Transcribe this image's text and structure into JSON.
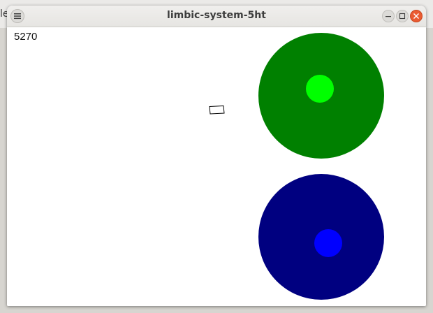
{
  "window": {
    "title": "limbic-system-5ht"
  },
  "desktop": {
    "background_fragment": "le"
  },
  "hud": {
    "score": "5270"
  },
  "icons": {
    "menu": "hamburger-menu-icon",
    "minimize": "minimize-icon",
    "maximize": "maximize-icon",
    "close": "close-icon"
  },
  "colors": {
    "upper_target_outer": "#008000",
    "upper_target_inner": "#00ff00",
    "lower_target_outer": "#000080",
    "lower_target_inner": "#0000ff",
    "close_button": "#e95b32",
    "agent_outline": "#000000"
  }
}
